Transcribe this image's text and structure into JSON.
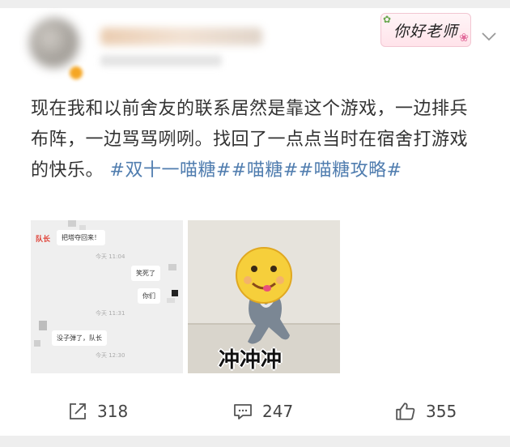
{
  "header": {
    "sticker_text": "你好老师",
    "more_icon": "chevron-down-icon"
  },
  "post": {
    "body": "现在我和以前舍友的联系居然是靠这个游戏，一边排兵布阵，一边骂骂咧咧。找回了一点点当时在宿舍打游戏的快乐。",
    "tags": "#双十一喵糖##喵糖##喵糖攻略#"
  },
  "images": {
    "chat": {
      "leader_label": "队长",
      "msg1": "把塔夺回来！",
      "time1": "今天 11:04",
      "msg2": "笑死了",
      "msg3": "你们",
      "time2": "今天 11:31",
      "msg4": "没子弹了，队长",
      "time3": "今天 12:30"
    },
    "meme": {
      "caption": "冲冲冲"
    }
  },
  "actions": {
    "repost": {
      "icon": "share-icon",
      "count": "318"
    },
    "comment": {
      "icon": "comment-icon",
      "count": "247"
    },
    "like": {
      "icon": "thumbs-up-icon",
      "count": "355"
    }
  }
}
